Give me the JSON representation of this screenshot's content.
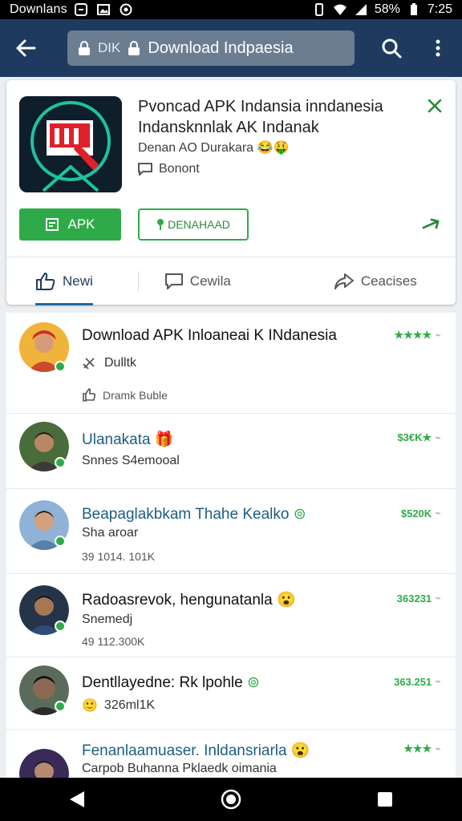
{
  "status_bar": {
    "title": "Downlans",
    "battery": "58%",
    "time": "7:25"
  },
  "app_bar": {
    "url_prefix": "DIK",
    "url_text": "Download Indpaesia"
  },
  "detail": {
    "title": "Pvoncad APK Indansia inndanesia Indansknnlak AK Indanak",
    "subtitle": "Denan AO Durakara",
    "meta": "Bonont",
    "apk_button": "APK",
    "download_button": "DENAHAAD",
    "tabs": [
      {
        "label": "Newi"
      },
      {
        "label": "Cewila"
      },
      {
        "label": "Ceacises"
      }
    ]
  },
  "list": [
    {
      "title": "Download APK Inloaneai K INdanesia",
      "line1": "Dulltk",
      "line2": "Dramk Buble",
      "right": "★★★★",
      "avatar_color": "#c94a2c"
    },
    {
      "title": "Ulanakata",
      "line1": "Snnes S4emooal",
      "line2": "",
      "right": "$3€K★",
      "avatar_color": "#4a6b3a"
    },
    {
      "title": "Beapaglakbkam Thahe Kealko",
      "line1": "Sha  aroar",
      "line2": "39 1014. 101K",
      "right": "$520K",
      "avatar_color": "#5a7fa8"
    },
    {
      "title": "Radoasrevok, hengunatanla",
      "line1": "Snemedj",
      "line2": "49 112.300K",
      "right": "363231",
      "avatar_color": "#2f4d78"
    },
    {
      "title": "Dentllayedne: Rk lpohle",
      "line1": "326ml1K",
      "line2": "",
      "right": "363.251",
      "avatar_color": "#3a4a40"
    },
    {
      "title": "Fenanlaamuaser. Inldansriarla",
      "line1": "Carpob Buhanna Pklaedk oimania",
      "line2": "",
      "right": "★★★",
      "avatar_color": "#6b3a58"
    }
  ],
  "colors": {
    "accent_green": "#2eab48",
    "app_bar": "#1e3a5f",
    "link_blue": "#1b5e83"
  }
}
